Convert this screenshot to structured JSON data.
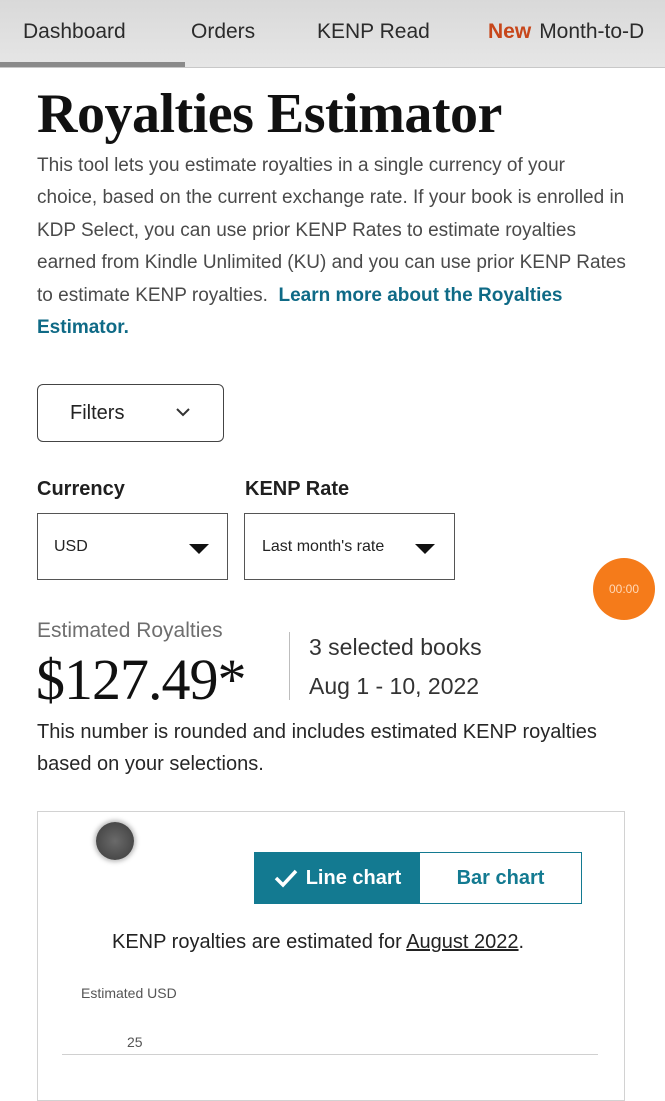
{
  "nav": {
    "items": [
      "Dashboard",
      "Orders",
      "KENP Read"
    ],
    "new_badge": "New",
    "last_item": "Month-to-D"
  },
  "page": {
    "title": "Royalties Estimator",
    "intro": "This tool lets you estimate royalties in a single currency of your choice, based on the current exchange rate. If your book is enrolled in KDP Select, you can use prior KENP Rates to estimate royalties earned from Kindle Unlimited (KU) and you can use prior KENP Rates to estimate KENP royalties.",
    "learn_more": "Learn more about the Royalties Estimator."
  },
  "filters": {
    "label": "Filters",
    "icon": "chevron-down-icon"
  },
  "currency": {
    "label": "Currency",
    "value": "USD"
  },
  "kenp_rate": {
    "label": "KENP Rate",
    "value": "Last month's rate"
  },
  "timer": {
    "value": "00:00"
  },
  "estimate": {
    "label": "Estimated Royalties",
    "amount": "$127.49*",
    "books": "3 selected books",
    "date_range": "Aug 1 - 10, 2022",
    "note": "This number is rounded and includes estimated KENP royalties based on your selections."
  },
  "chart": {
    "toggle": {
      "line": "Line chart",
      "bar": "Bar chart",
      "selected": "line"
    },
    "kenp_note_prefix": "KENP royalties are estimated for ",
    "kenp_note_month": "August 2022",
    "kenp_note_suffix": ".",
    "y_axis_title": "Estimated USD",
    "y_ticks": [
      "25"
    ]
  },
  "colors": {
    "accent": "#137a91",
    "link": "#0f6a86",
    "new_badge": "#c7461a",
    "timer": "#f57b1a"
  }
}
